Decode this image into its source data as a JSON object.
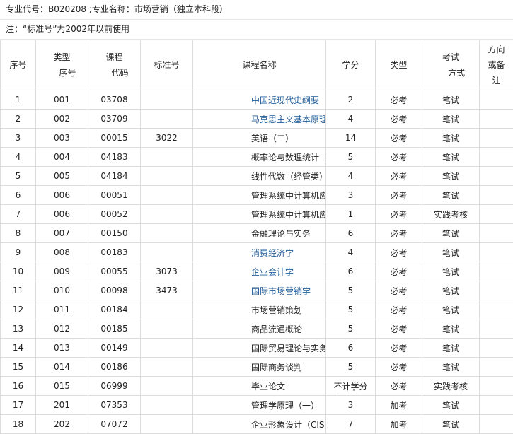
{
  "header": {
    "major_line": "专业代号：B020208 ;专业名称：市场营销（独立本科段）",
    "note_line": "注：“标准号”为2002年以前使用"
  },
  "table": {
    "headers": {
      "seq": "序号",
      "type_seq": [
        "类型",
        "序号"
      ],
      "course_code": [
        "课程",
        "代码"
      ],
      "standard_no": "标准号",
      "course_name": "课程名称",
      "credits": "学分",
      "type": "类型",
      "exam_method": [
        "考试",
        "方式"
      ],
      "direction_note": [
        "方向",
        "或备",
        "注"
      ]
    },
    "rows": [
      {
        "seq": "1",
        "type_seq": "001",
        "code": "03708",
        "std": "",
        "name": "中国近现代史纲要",
        "link": true,
        "credits": "2",
        "type": "必考",
        "exam": "笔试",
        "note": ""
      },
      {
        "seq": "2",
        "type_seq": "002",
        "code": "03709",
        "std": "",
        "name": "马克思主义基本原理概论",
        "link": true,
        "credits": "4",
        "type": "必考",
        "exam": "笔试",
        "note": ""
      },
      {
        "seq": "3",
        "type_seq": "003",
        "code": "00015",
        "std": "3022",
        "name": "英语（二）",
        "link": false,
        "credits": "14",
        "type": "必考",
        "exam": "笔试",
        "note": ""
      },
      {
        "seq": "4",
        "type_seq": "004",
        "code": "04183",
        "std": "",
        "name": "概率论与数理统计（经管类）",
        "link": false,
        "credits": "5",
        "type": "必考",
        "exam": "笔试",
        "note": ""
      },
      {
        "seq": "5",
        "type_seq": "005",
        "code": "04184",
        "std": "",
        "name": "线性代数（经管类）",
        "link": false,
        "credits": "4",
        "type": "必考",
        "exam": "笔试",
        "note": ""
      },
      {
        "seq": "6",
        "type_seq": "006",
        "code": "00051",
        "std": "",
        "name": "管理系统中计算机应用",
        "link": false,
        "credits": "3",
        "type": "必考",
        "exam": "笔试",
        "note": ""
      },
      {
        "seq": "7",
        "type_seq": "006",
        "code": "00052",
        "std": "",
        "name": "管理系统中计算机应用",
        "link": false,
        "credits": "1",
        "type": "必考",
        "exam": "实践考核",
        "note": ""
      },
      {
        "seq": "8",
        "type_seq": "007",
        "code": "00150",
        "std": "",
        "name": "金融理论与实务",
        "link": false,
        "credits": "6",
        "type": "必考",
        "exam": "笔试",
        "note": ""
      },
      {
        "seq": "9",
        "type_seq": "008",
        "code": "00183",
        "std": "",
        "name": "消费经济学",
        "link": true,
        "credits": "4",
        "type": "必考",
        "exam": "笔试",
        "note": ""
      },
      {
        "seq": "10",
        "type_seq": "009",
        "code": "00055",
        "std": "3073",
        "name": "企业会计学",
        "link": true,
        "credits": "6",
        "type": "必考",
        "exam": "笔试",
        "note": ""
      },
      {
        "seq": "11",
        "type_seq": "010",
        "code": "00098",
        "std": "3473",
        "name": "国际市场营销学",
        "link": true,
        "credits": "5",
        "type": "必考",
        "exam": "笔试",
        "note": ""
      },
      {
        "seq": "12",
        "type_seq": "011",
        "code": "00184",
        "std": "",
        "name": "市场营销策划",
        "link": false,
        "credits": "5",
        "type": "必考",
        "exam": "笔试",
        "note": ""
      },
      {
        "seq": "13",
        "type_seq": "012",
        "code": "00185",
        "std": "",
        "name": "商品流通概论",
        "link": false,
        "credits": "5",
        "type": "必考",
        "exam": "笔试",
        "note": ""
      },
      {
        "seq": "14",
        "type_seq": "013",
        "code": "00149",
        "std": "",
        "name": "国际贸易理论与实务",
        "link": false,
        "credits": "6",
        "type": "必考",
        "exam": "笔试",
        "note": ""
      },
      {
        "seq": "15",
        "type_seq": "014",
        "code": "00186",
        "std": "",
        "name": "国际商务谈判",
        "link": false,
        "credits": "5",
        "type": "必考",
        "exam": "笔试",
        "note": ""
      },
      {
        "seq": "16",
        "type_seq": "015",
        "code": "06999",
        "std": "",
        "name": "毕业论文",
        "link": false,
        "credits": "不计学分",
        "type": "必考",
        "exam": "实践考核",
        "note": ""
      },
      {
        "seq": "17",
        "type_seq": "201",
        "code": "07353",
        "std": "",
        "name": "管理学原理（一）",
        "link": false,
        "credits": "3",
        "type": "加考",
        "exam": "笔试",
        "note": ""
      },
      {
        "seq": "18",
        "type_seq": "202",
        "code": "07072",
        "std": "",
        "name": "企业形象设计（CIS）",
        "link": false,
        "credits": "7",
        "type": "加考",
        "exam": "笔试",
        "note": ""
      }
    ]
  }
}
